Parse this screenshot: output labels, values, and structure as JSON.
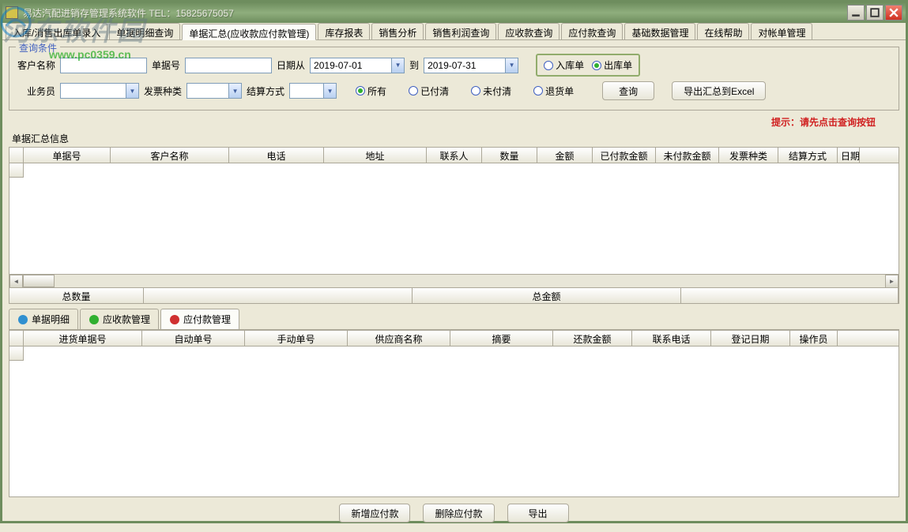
{
  "window": {
    "title": "易达汽配进销存管理系统软件 TEL：15825675057"
  },
  "watermark": {
    "text1": "河东软件园",
    "text2": "www.pc0359.cn"
  },
  "mainTabs": [
    "入库/消售出库单录入",
    "单据明细查询",
    "单据汇总(应收款应付款管理)",
    "库存报表",
    "销售分析",
    "销售利润查询",
    "应收款查询",
    "应付款查询",
    "基础数据管理",
    "在线帮助",
    "对帐单管理"
  ],
  "mainTabActive": 2,
  "query": {
    "fieldsetTitle": "查询条件",
    "customerLabel": "客户名称",
    "customerValue": "",
    "docNoLabel": "单据号",
    "docNoValue": "",
    "dateFromLabel": "日期从",
    "dateFrom": "2019-07-01",
    "dateToLabel": "到",
    "dateTo": "2019-07-31",
    "inboundLabel": "入库单",
    "outboundLabel": "出库单",
    "salesmanLabel": "业务员",
    "salesmanValue": "",
    "invoiceTypeLabel": "发票种类",
    "invoiceTypeValue": "",
    "settlementLabel": "结算方式",
    "settlementValue": "",
    "radioAll": "所有",
    "radioPaid": "已付清",
    "radioUnpaid": "未付清",
    "radioReturn": "退货单",
    "searchBtn": "查询",
    "exportBtn": "导出汇总到Excel",
    "hint": "提示：请先点击查询按钮"
  },
  "grid1": {
    "title": "单据汇总信息",
    "headers": [
      "单据号",
      "客户名称",
      "电话",
      "地址",
      "联系人",
      "数量",
      "金额",
      "已付款金额",
      "未付款金额",
      "发票种类",
      "结算方式",
      "日期"
    ],
    "widths": [
      110,
      150,
      120,
      130,
      70,
      70,
      70,
      80,
      80,
      75,
      75,
      28
    ]
  },
  "summary": {
    "totalQtyLabel": "总数量",
    "totalAmtLabel": "总金额"
  },
  "subTabs": [
    {
      "label": "单据明细",
      "iconColor": "#3090d0"
    },
    {
      "label": "应收款管理",
      "iconColor": "#30b030"
    },
    {
      "label": "应付款管理",
      "iconColor": "#d03030"
    }
  ],
  "subTabActive": 2,
  "grid2": {
    "headers": [
      "进货单据号",
      "自动单号",
      "手动单号",
      "供应商名称",
      "摘要",
      "还款金额",
      "联系电话",
      "登记日期",
      "操作员"
    ],
    "widths": [
      150,
      130,
      130,
      130,
      130,
      100,
      100,
      100,
      60
    ]
  },
  "footer": {
    "addBtn": "新增应付款",
    "delBtn": "删除应付款",
    "exportBtn": "导出"
  }
}
